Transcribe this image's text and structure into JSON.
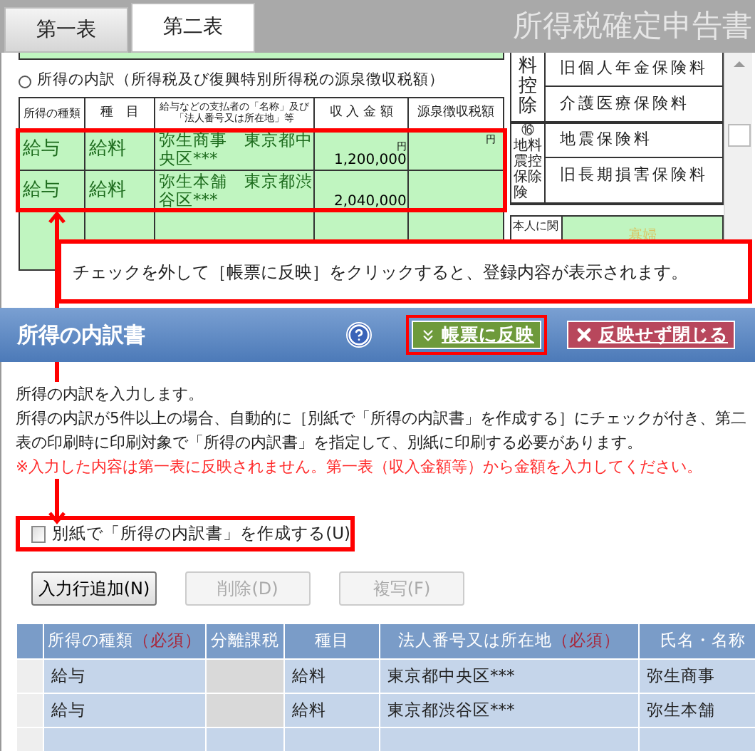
{
  "tabs": [
    {
      "label": "第一表",
      "selected": false
    },
    {
      "label": "第二表",
      "selected": true
    }
  ],
  "app_title": "所得税確定申告書",
  "income_section": {
    "heading": "所得の内訳（所得税及び復興特別所得税の源泉徴収税額）",
    "highlighted": true,
    "columns": [
      "所得の種類",
      "種　目",
      "給与などの支払者の「名称」及び「法人番号又は所在地」等",
      "収 入 金 額",
      "源泉徴収税額"
    ],
    "rows": [
      {
        "type": "給与",
        "item": "給料",
        "payer": "弥生商事　東京都中央区***",
        "amount_unit": "円",
        "amount": "1,200,000",
        "tax_unit": "円"
      },
      {
        "type": "給与",
        "item": "給料",
        "payer": "弥生本舗　東京都渋谷区***",
        "amount": "2,040,000"
      }
    ]
  },
  "deductions": [
    {
      "label": "料控除",
      "items": [
        "旧個人年金保険料",
        "介護医療保険料"
      ]
    },
    {
      "number": "⑯",
      "label": "地震保険",
      "label_2": "料控除",
      "items": [
        "地震保険料",
        "旧長期損害保険料"
      ]
    }
  ],
  "personal": {
    "label": "本人に関",
    "widow": "寡婦"
  },
  "callout": "チェックを外して［帳票に反映］をクリックすると、登録内容が表示されます。",
  "dialog": {
    "title": "所得の内訳書",
    "buttons": [
      {
        "label": "帳票に反映",
        "kind": "apply",
        "highlighted": true
      },
      {
        "label": "反映せず閉じる",
        "kind": "close"
      }
    ],
    "description": [
      "所得の内訳を入力します。",
      "所得の内訳が5件以上の場合、自動的に［別紙で「所得の内訳書」を作成する］にチェックが付き、第二表の印刷時に印刷対象で「所得の内訳書」を指定して、別紙に印刷する必要があります。"
    ],
    "note": "※入力した内容は第一表に反映されません。第一表（収入金額等）から金額を入力してください。",
    "separate_sheet": {
      "label": "別紙で「所得の内訳書」を作成する(U)",
      "checked": false,
      "highlighted": true
    },
    "actions": [
      {
        "label": "入力行追加(N)",
        "disabled": false
      },
      {
        "label": "削除(D)",
        "disabled": true
      },
      {
        "label": "複写(F)",
        "disabled": true
      }
    ],
    "grid": {
      "columns": [
        {
          "label": "所得の種類",
          "required": "（必須）"
        },
        {
          "label": "分離課税"
        },
        {
          "label": "種目"
        },
        {
          "label": "法人番号又は所在地",
          "required": "（必須）"
        },
        {
          "label": "氏名・名称"
        }
      ],
      "rows": [
        {
          "type": "給与",
          "item": "給料",
          "address": "東京都中央区***",
          "name": "弥生商事"
        },
        {
          "type": "給与",
          "item": "給料",
          "address": "東京都渋谷区***",
          "name": "弥生本舗"
        }
      ]
    }
  }
}
